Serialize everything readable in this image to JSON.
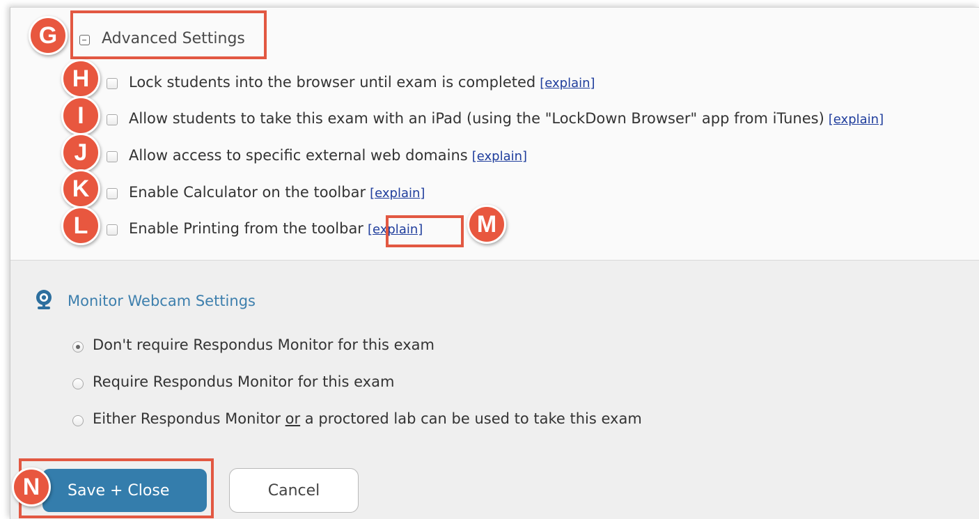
{
  "advanced": {
    "title": "Advanced Settings",
    "options": [
      {
        "label": "Lock students into the browser until exam is completed",
        "explain": "[explain]",
        "checked": false
      },
      {
        "label": "Allow students to take this exam with an iPad (using the \"LockDown Browser\" app from iTunes)",
        "explain": "[explain]",
        "checked": false
      },
      {
        "label": "Allow access to specific external web domains",
        "explain": "[explain]",
        "checked": false
      },
      {
        "label": "Enable Calculator on the toolbar",
        "explain": "[explain]",
        "checked": false
      },
      {
        "label": "Enable Printing from the toolbar",
        "explain": "[explain]",
        "checked": false
      }
    ]
  },
  "webcam": {
    "title": "Monitor Webcam Settings",
    "options": [
      {
        "label": "Don't require Respondus Monitor for this exam",
        "selected": true
      },
      {
        "label": "Require Respondus Monitor for this exam",
        "selected": false
      },
      {
        "label_before": "Either Respondus Monitor ",
        "label_emph": "or",
        "label_after": " a proctored lab can be used to take this exam",
        "selected": false
      }
    ]
  },
  "buttons": {
    "save": "Save + Close",
    "cancel": "Cancel"
  },
  "callouts": {
    "g": "G",
    "h": "H",
    "i": "I",
    "j": "J",
    "k": "K",
    "l": "L",
    "m": "M",
    "n": "N"
  },
  "colors": {
    "callout": "#e8573f",
    "primary_button": "#347dac",
    "link": "#1f3d9c",
    "section_title": "#3d7fad"
  }
}
